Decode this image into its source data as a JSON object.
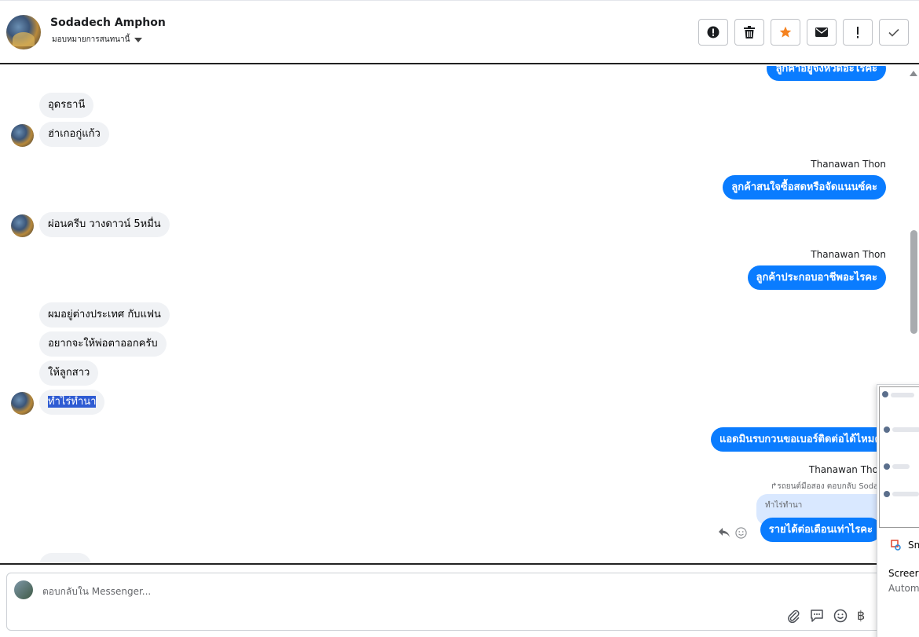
{
  "header": {
    "contact_name": "Sodadech Amphon",
    "assign_label": "มอบหมายการสนทนานี้"
  },
  "toolbar": {
    "buttons": [
      "alert-circle-icon",
      "trash-icon",
      "star-icon",
      "mail-icon",
      "exclamation-icon",
      "check-icon"
    ],
    "star_color": "#f5821f"
  },
  "messages": {
    "out_top": "ลูกค้าอยู่จังหวัดอะไรคะ",
    "in_1": "อุดรธานี",
    "in_2": "ฮ่าเกอกู่แก้ว",
    "sender_1": "Thanawan Thon",
    "out_1": "ลูกค้าสนใจซื้อสดหรือจัดแนนซ์คะ",
    "in_3": "ผ่อนครีบ  วางดาวน์ 5หมื่น",
    "sender_2": "Thanawan Thon",
    "out_2": "ลูกค้าประกอบอาชีพอะไรคะ",
    "in_4": "ผมอยู่ต่างประเทศ กับแฟน",
    "in_5": "อยากจะให้พ่อตาออกครับ",
    "in_6": "ให้ลูกสาว",
    "in_7": "ทำไร่ทำนา",
    "out_3": "แอดมินรบกวนขอเบอร์ติดต่อได้ไหมคะ",
    "sender_3": "Thanawan Tho",
    "reply_meta": "↱รถยนต์มือสอง ตอบกลับ Sodade",
    "quoted_text": "ทำไร่ทำนา",
    "out_4": "รายได้ต่อเดือนเท่าไรคะ"
  },
  "popup": {
    "app_label": "Sn",
    "line_1": "Screer",
    "line_2": "Autom"
  },
  "composer": {
    "placeholder": "ตอบกลับใน Messenger...",
    "currency_symbol": "฿"
  },
  "colors": {
    "outgoing_bubble": "#0a7cff",
    "incoming_bubble": "#f0f2f5",
    "selection": "#2f5cd3"
  }
}
